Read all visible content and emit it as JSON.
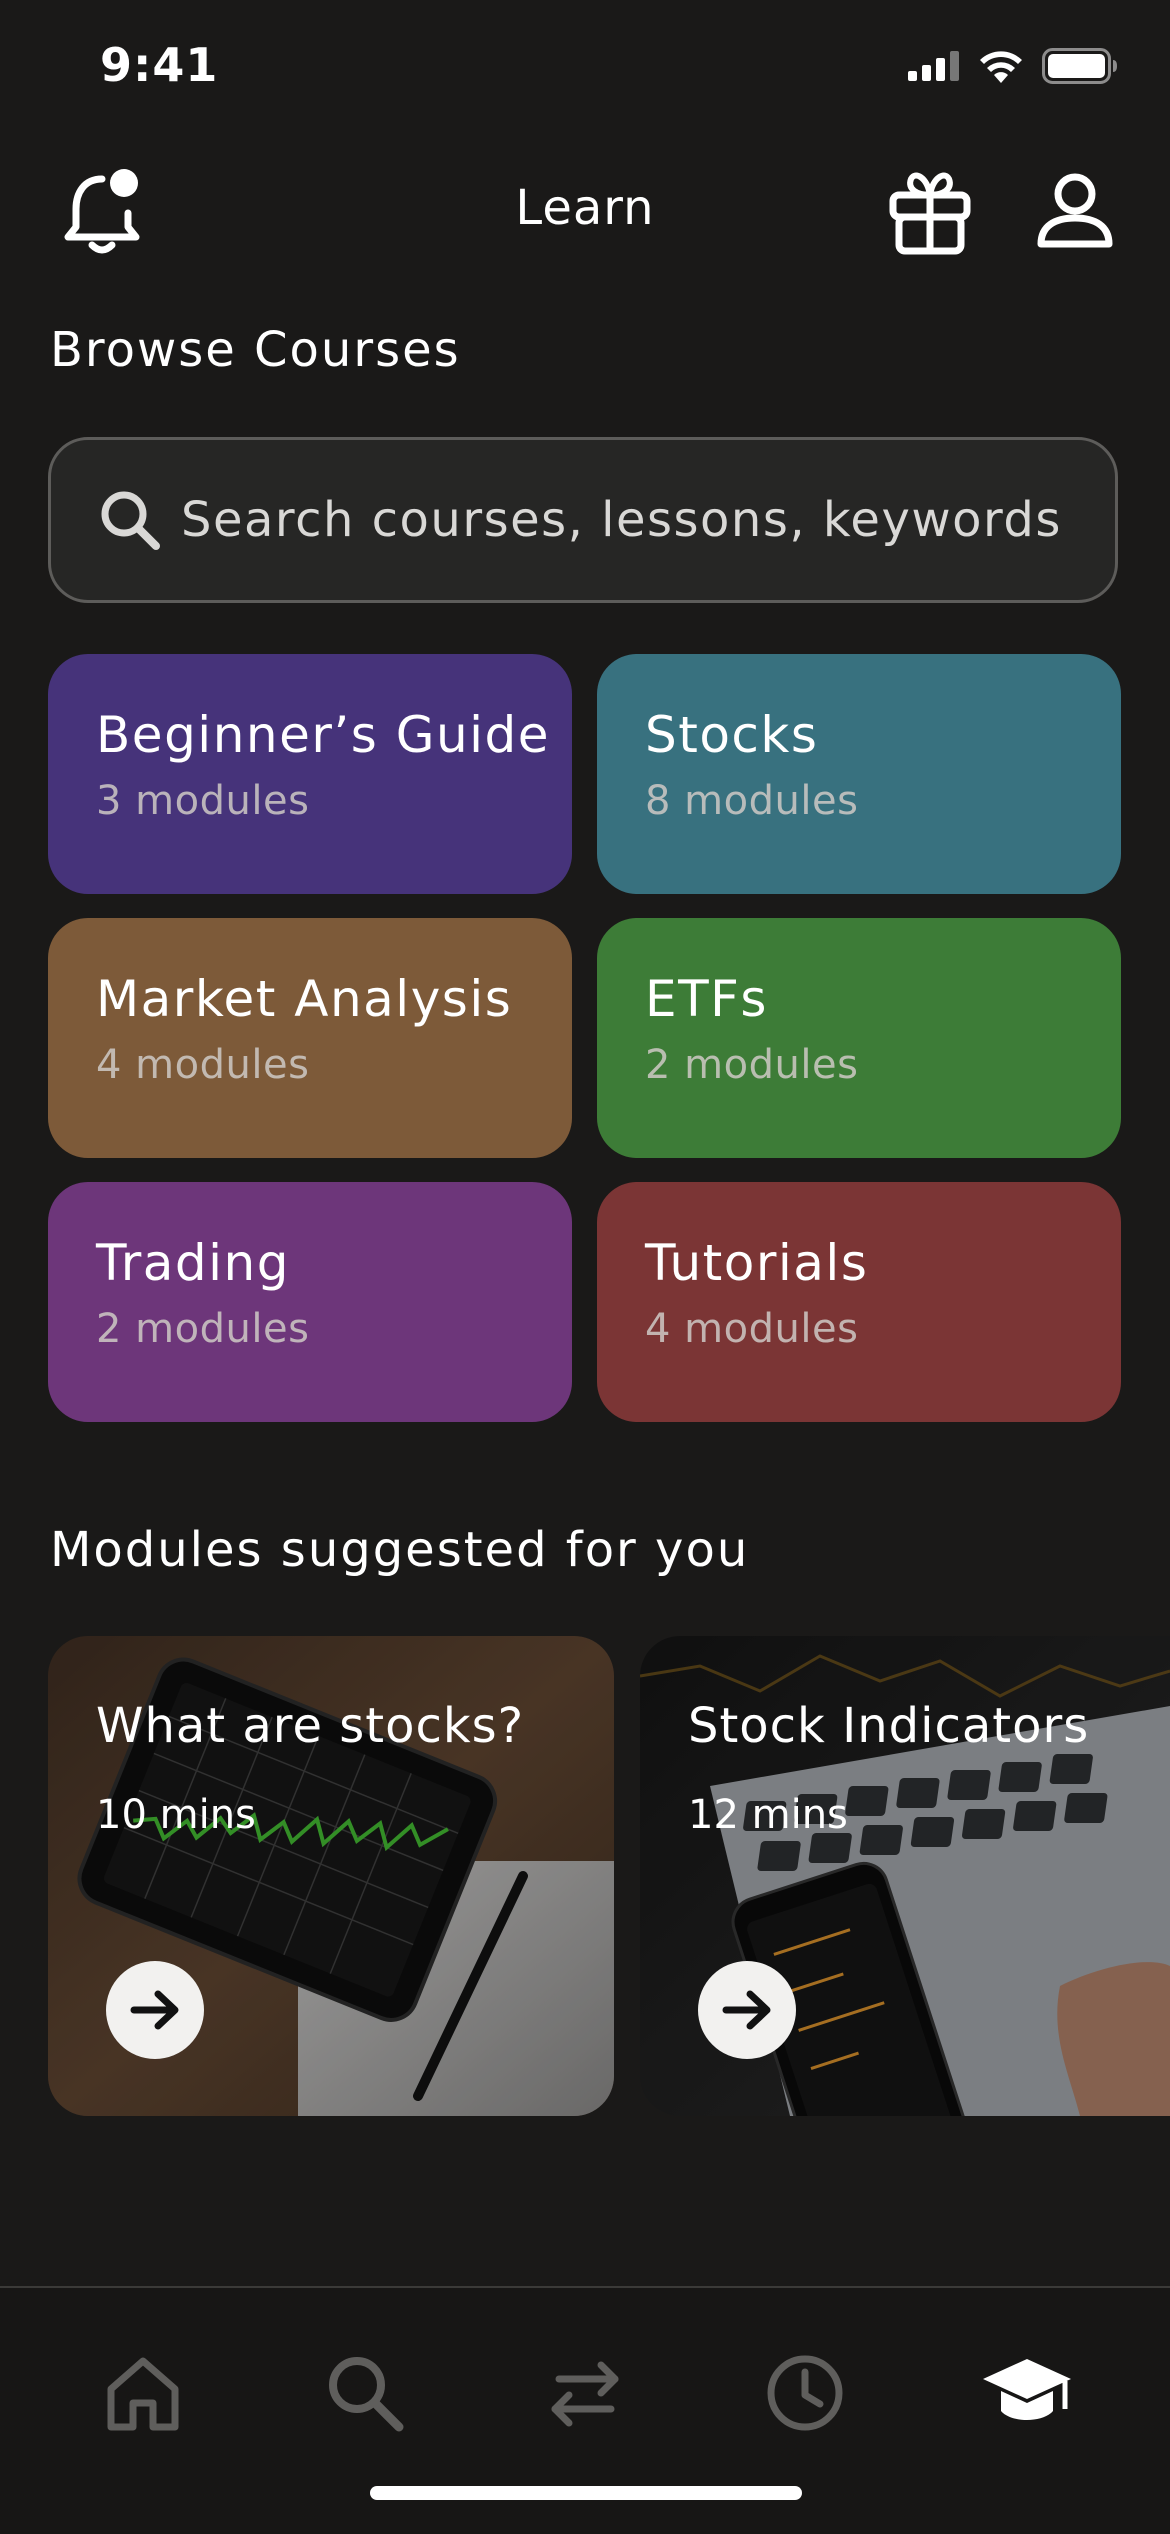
{
  "status_bar": {
    "time": "9:41"
  },
  "header": {
    "title": "Learn"
  },
  "browse": {
    "title": "Browse Courses",
    "search_placeholder": "Search courses, lessons, keywords"
  },
  "courses": [
    {
      "title": "Beginner’s Guide",
      "subtitle": "3 modules",
      "color": "#46337a"
    },
    {
      "title": "Stocks",
      "subtitle": "8 modules",
      "color": "#38717f"
    },
    {
      "title": "Market Analysis",
      "subtitle": "4 modules",
      "color": "#7d5a39"
    },
    {
      "title": "ETFs",
      "subtitle": "2 modules",
      "color": "#3d7c37"
    },
    {
      "title": "Trading",
      "subtitle": "2 modules",
      "color": "#6d367a"
    },
    {
      "title": "Tutorials",
      "subtitle": "4 modules",
      "color": "#7b3535"
    }
  ],
  "suggested": {
    "title": "Modules suggested for you",
    "modules": [
      {
        "title": "What are stocks?",
        "duration": "10 mins"
      },
      {
        "title": "Stock Indicators",
        "duration": "12 mins"
      }
    ]
  },
  "tabbar": {
    "items": [
      {
        "icon": "home-icon",
        "active": false
      },
      {
        "icon": "search-icon",
        "active": false
      },
      {
        "icon": "transfer-icon",
        "active": false
      },
      {
        "icon": "history-icon",
        "active": false
      },
      {
        "icon": "graduation-cap-icon",
        "active": true
      }
    ],
    "active_color": "#ffffff",
    "inactive_color": "#5f5e5c"
  }
}
